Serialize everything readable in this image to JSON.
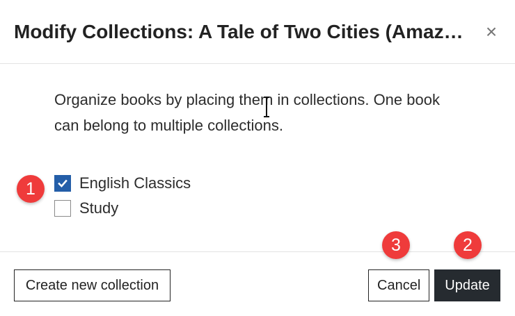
{
  "dialog": {
    "title": "Modify Collections: A Tale of Two Cities (Amazon Classics Edition)",
    "close_icon": "×",
    "description": "Organize books by placing them in collections. One book can belong to multiple collections."
  },
  "collections": [
    {
      "label": "English Classics",
      "checked": true
    },
    {
      "label": "Study",
      "checked": false
    }
  ],
  "buttons": {
    "create": "Create new collection",
    "cancel": "Cancel",
    "update": "Update"
  },
  "annotations": {
    "badge_1": "1",
    "badge_2": "2",
    "badge_3": "3"
  },
  "colors": {
    "accent": "#245ea8",
    "badge": "#ef3b3b",
    "primary_button": "#262b30"
  },
  "icons": {
    "close": "close-icon",
    "check": "checkmark-icon",
    "cursor": "text-cursor-icon"
  }
}
